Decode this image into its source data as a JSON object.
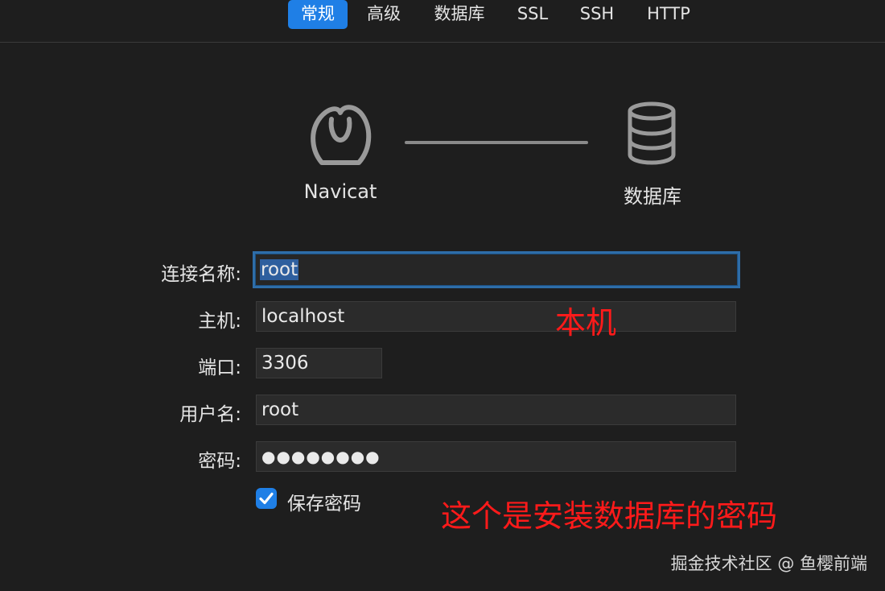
{
  "tabs": [
    {
      "label": "常规",
      "active": true
    },
    {
      "label": "高级",
      "active": false
    },
    {
      "label": "数据库",
      "active": false
    },
    {
      "label": "SSL",
      "active": false
    },
    {
      "label": "SSH",
      "active": false
    },
    {
      "label": "HTTP",
      "active": false
    }
  ],
  "diagram": {
    "left_caption": "Navicat",
    "right_caption": "数据库",
    "left_icon": "navicat-logo-icon",
    "right_icon": "database-icon"
  },
  "form": {
    "connection_name": {
      "label": "连接名称:",
      "value": "root"
    },
    "host": {
      "label": "主机:",
      "value": "localhost"
    },
    "port": {
      "label": "端口:",
      "value": "3306"
    },
    "username": {
      "label": "用户名:",
      "value": "root"
    },
    "password": {
      "label": "密码:",
      "value": "●●●●●●●●"
    },
    "save_password": {
      "label": "保存密码",
      "checked": true
    }
  },
  "annotations": {
    "host_note": "本机",
    "password_note": "这个是安装数据库的密码"
  },
  "watermark": "掘金技术社区 @ 鱼樱前端",
  "colors": {
    "background": "#1e1e1e",
    "accent": "#1f7fe6",
    "annotation": "#ff1a1a",
    "focus_ring": "#2e6da8"
  }
}
